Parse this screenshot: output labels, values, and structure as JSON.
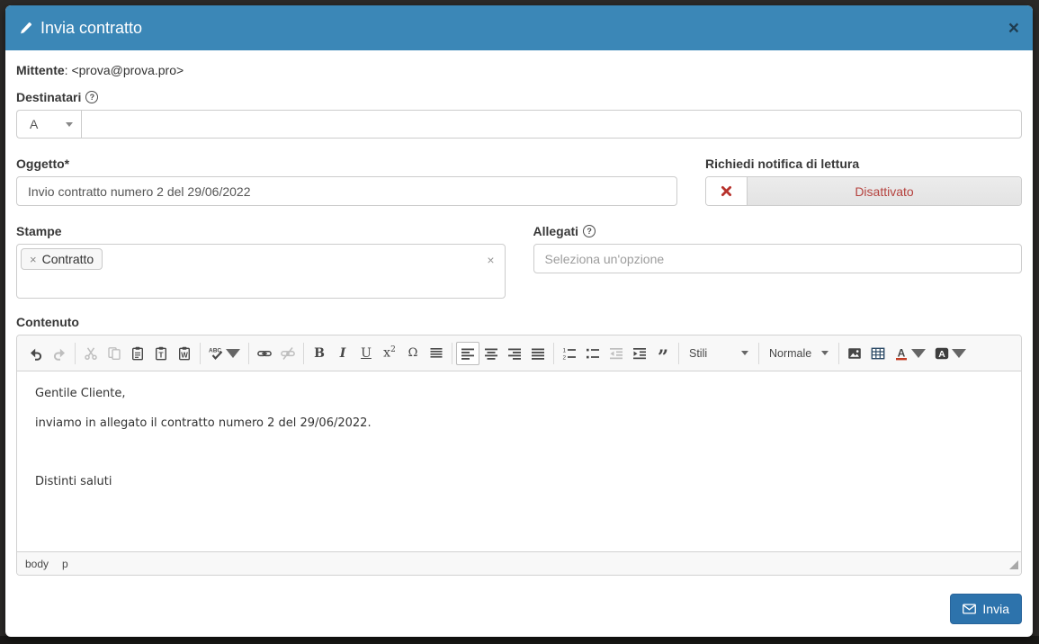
{
  "header": {
    "title": "Invia contratto",
    "close_label": "×"
  },
  "sender": {
    "label": "Mittente",
    "value": ": <prova@prova.pro>"
  },
  "recipients": {
    "label": "Destinatari",
    "help_label": "?",
    "to_selector_value": "A",
    "input_value": ""
  },
  "subject": {
    "label": "Oggetto*",
    "value": "Invio contratto numero 2 del 29/06/2022"
  },
  "read_receipt": {
    "label": "Richiedi notifica di lettura",
    "status": "Disattivato"
  },
  "prints": {
    "label": "Stampe",
    "tag": "Contratto",
    "tag_remove": "×",
    "clear": "×"
  },
  "attachments": {
    "label": "Allegati",
    "help_label": "?",
    "placeholder": "Seleziona un'opzione"
  },
  "editor": {
    "label": "Contenuto",
    "styles_dropdown": "Stili",
    "format_dropdown": "Normale",
    "glyphs": {
      "bold": "B",
      "italic": "I",
      "underline": "U",
      "sup_base": "x",
      "sup_exp": "2",
      "omega": "Ω",
      "quote": "”"
    },
    "toolbar_icons": [
      "undo",
      "redo",
      "cut",
      "copy",
      "paste",
      "paste-plain-text",
      "paste-from-word",
      "spell-check",
      "link",
      "unlink",
      "bold",
      "italic",
      "underline",
      "superscript",
      "special-character",
      "line-spacing",
      "align-left",
      "align-center",
      "align-right",
      "justify",
      "numbered-list",
      "bulleted-list",
      "decrease-indent",
      "increase-indent",
      "blockquote",
      "styles",
      "format",
      "image",
      "table",
      "text-color",
      "background-color"
    ],
    "paragraphs": [
      "Gentile Cliente,",
      "inviamo in allegato il contratto numero 2 del 29/06/2022.",
      "",
      "Distinti saluti"
    ],
    "elements_path": [
      "body",
      "p"
    ]
  },
  "footer": {
    "send_label": "Invia"
  },
  "colors": {
    "header_bg": "#3b87b7",
    "send_button_bg": "#2d73ac",
    "danger_text": "#b5423e",
    "toggle_off_bg": "#e8e8e8"
  }
}
